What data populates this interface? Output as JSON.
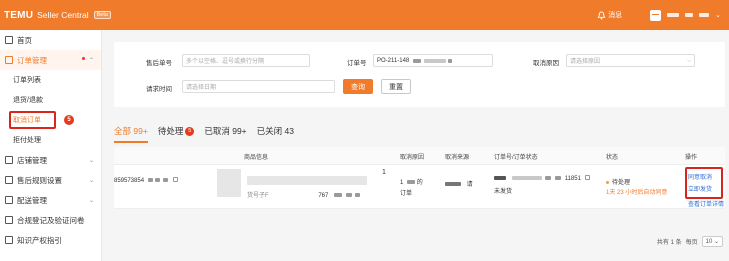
{
  "header": {
    "brand": "TEMU",
    "app_name": "Seller Central",
    "beta": "Beta",
    "notification_label": "消息",
    "brand_color": "#f07b2b"
  },
  "sidebar": {
    "items": [
      {
        "label": "首页",
        "icon": "home-icon"
      },
      {
        "label": "订单管理",
        "icon": "order-icon",
        "active": true
      },
      {
        "label": "店铺管理",
        "icon": "store-icon"
      },
      {
        "label": "售后规则设置",
        "icon": "aftersale-icon"
      },
      {
        "label": "配送管理",
        "icon": "delivery-icon"
      },
      {
        "label": "合规登记及验证问卷",
        "icon": "compliance-icon"
      },
      {
        "label": "知识产权指引",
        "icon": "ip-icon"
      }
    ],
    "order_sub": [
      {
        "label": "订单列表"
      },
      {
        "label": "退货/退款"
      },
      {
        "label": "取消订单",
        "badge": "5"
      },
      {
        "label": "拒付处理"
      }
    ]
  },
  "filters": {
    "order_no_label": "售后单号",
    "order_no_placeholder": "多个以空格、逗号或换行分隔",
    "order_id_label": "订单号",
    "order_id_value": "PO-211-148",
    "reason_label": "取消原因",
    "reason_placeholder": "请选择原因",
    "time_label": "请求时间",
    "time_placeholder": "请选择日期",
    "search_button": "查询",
    "reset_button": "重置"
  },
  "tabs": [
    {
      "label": "全部",
      "count": "99+"
    },
    {
      "label": "待处理",
      "badge": "5"
    },
    {
      "label": "已取消",
      "count": "99+"
    },
    {
      "label": "已关闭",
      "count": "43"
    }
  ],
  "table": {
    "headers": [
      "商品信息",
      "取消原因",
      "取消来源",
      "订单号/订单状态",
      "状态",
      "操作"
    ],
    "row": {
      "id_prefix": "859573854",
      "qty": "1",
      "product_id_label": "货号子F",
      "product_code": "767",
      "reason": "1",
      "reason_suffix": "的",
      "reason_line2": "订单",
      "source_suffix": "请",
      "order_suffix": "11851",
      "order_status": "未发货",
      "status": "待处理",
      "countdown": "1天 23 小时后自动同意",
      "actions": [
        "同意取消",
        "立即发货",
        "查看订单详情"
      ]
    }
  },
  "pagination": {
    "total": "共有 1 条",
    "per_page_label": "每页",
    "per_page_value": "10"
  }
}
